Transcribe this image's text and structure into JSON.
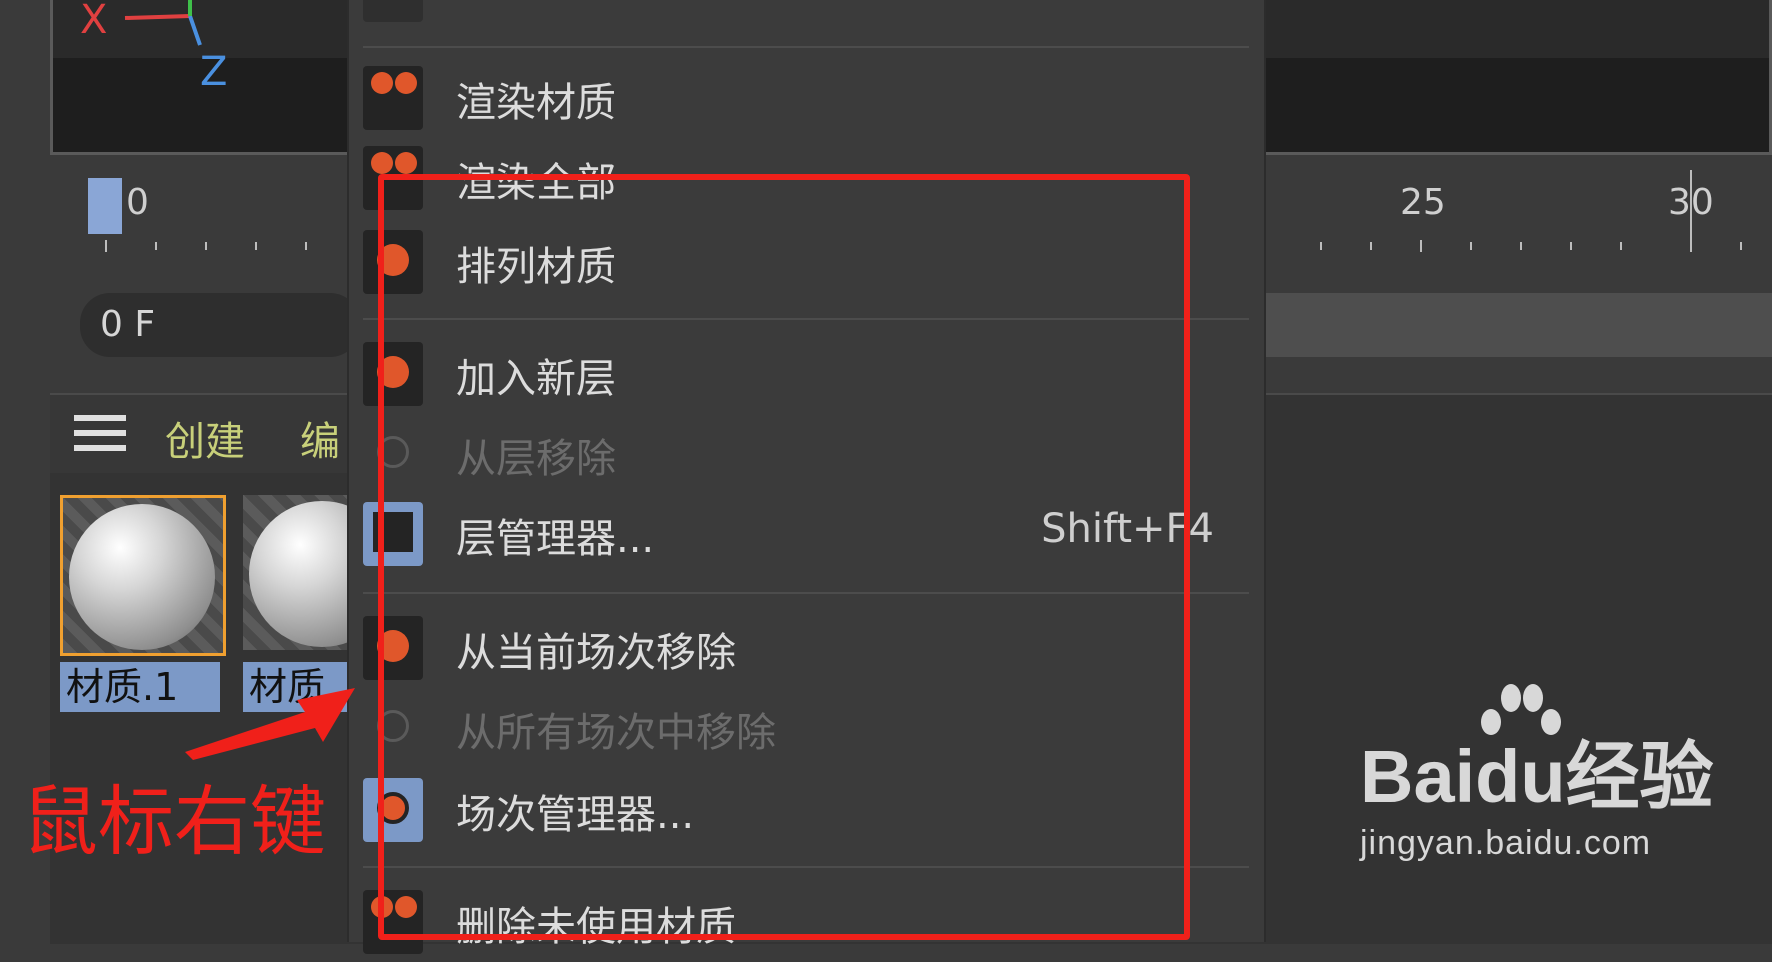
{
  "viewport": {
    "axis_x": "X",
    "axis_z": "Z"
  },
  "timeline": {
    "labels": [
      "0",
      "25",
      "30"
    ]
  },
  "frame_field": {
    "value": "0 F"
  },
  "material_manager": {
    "menus": [
      "创建",
      "编"
    ],
    "materials": [
      {
        "label": "材质.1",
        "selected": true
      },
      {
        "label": "材质",
        "selected": false
      }
    ]
  },
  "context_menu": {
    "items": [
      {
        "label": "渲染材质",
        "shortcut": "",
        "enabled": true,
        "icon": "render-material-icon"
      },
      {
        "label": "渲染全部",
        "shortcut": "",
        "enabled": true,
        "icon": "render-all-icon"
      },
      {
        "label": "排列材质",
        "shortcut": "",
        "enabled": true,
        "icon": "sort-material-icon"
      },
      {
        "label": "加入新层",
        "shortcut": "",
        "enabled": true,
        "icon": "add-layer-icon"
      },
      {
        "label": "从层移除",
        "shortcut": "",
        "enabled": false,
        "icon": "remove-from-layer-icon"
      },
      {
        "label": "层管理器...",
        "shortcut": "Shift+F4",
        "enabled": true,
        "icon": "layer-manager-icon"
      },
      {
        "label": "从当前场次移除",
        "shortcut": "",
        "enabled": true,
        "icon": "remove-from-take-icon"
      },
      {
        "label": "从所有场次中移除",
        "shortcut": "",
        "enabled": false,
        "icon": "remove-from-all-takes-icon"
      },
      {
        "label": "场次管理器...",
        "shortcut": "",
        "enabled": true,
        "icon": "take-manager-icon"
      },
      {
        "label": "删除未使用材质",
        "shortcut": "",
        "enabled": true,
        "icon": "delete-unused-icon"
      }
    ]
  },
  "annotation": {
    "text": "鼠标右键",
    "color": "#f0201a"
  },
  "watermark": {
    "brand_left": "Bai",
    "brand_mid": "du",
    "brand_right": "经验",
    "url": "jingyan.baidu.com"
  }
}
